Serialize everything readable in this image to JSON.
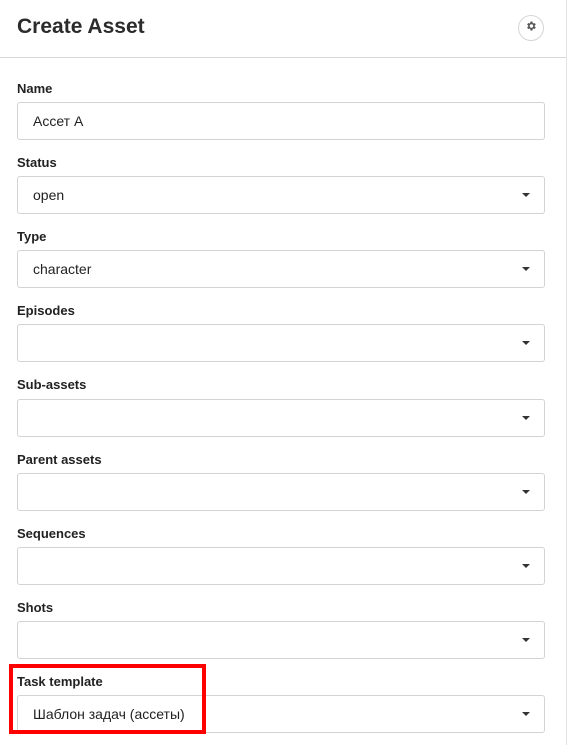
{
  "header": {
    "title": "Create Asset",
    "settings_icon": "gear-icon"
  },
  "form": {
    "name": {
      "label": "Name",
      "value": "Ассет А"
    },
    "status": {
      "label": "Status",
      "value": "open"
    },
    "type": {
      "label": "Type",
      "value": "character"
    },
    "episodes": {
      "label": "Episodes",
      "value": ""
    },
    "sub_assets": {
      "label": "Sub-assets",
      "value": ""
    },
    "parent_assets": {
      "label": "Parent assets",
      "value": ""
    },
    "sequences": {
      "label": "Sequences",
      "value": ""
    },
    "shots": {
      "label": "Shots",
      "value": ""
    },
    "task_template": {
      "label": "Task template",
      "value": "Шаблон задач (ассеты)"
    }
  },
  "colors": {
    "highlight": "#ff0000",
    "border": "#d3d3d3"
  }
}
